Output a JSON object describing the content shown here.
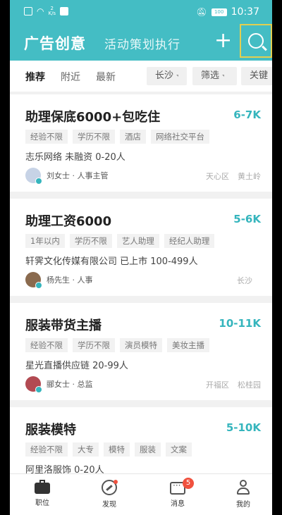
{
  "status_bar": {
    "speed_value": "2",
    "speed_unit": "K/s",
    "battery": "100",
    "time": "10:37"
  },
  "header": {
    "title": "广告创意",
    "subtitle": "活动策划执行",
    "plus_icon": "plus-icon",
    "search_icon": "search-icon"
  },
  "filters": {
    "tabs": [
      "推荐",
      "附近",
      "最新"
    ],
    "chips": [
      "长沙",
      "筛选",
      "关键"
    ]
  },
  "jobs": [
    {
      "title": "助理保底6000+包吃住",
      "salary": "6-7K",
      "tags": [
        "经验不限",
        "学历不限",
        "酒店",
        "网络社交平台"
      ],
      "company": "志乐网络  未融资  0-20人",
      "recruiter": "刘女士 · 人事主管",
      "district": "天心区",
      "area": "黄土岭"
    },
    {
      "title": "助理工资6000",
      "salary": "5-6K",
      "tags": [
        "1年以内",
        "学历不限",
        "艺人助理",
        "经纪人助理"
      ],
      "company": "轩霁文化传媒有限公司  已上市  100-499人",
      "recruiter": "杨先生 · 人事",
      "district": "长沙",
      "area": ""
    },
    {
      "title": "服装带货主播",
      "salary": "10-11K",
      "tags": [
        "经验不限",
        "学历不限",
        "演员模特",
        "美妆主播"
      ],
      "company": "星光直播供应链  20-99人",
      "recruiter": "郦女士 · 总监",
      "district": "开福区",
      "area": "松桂园"
    },
    {
      "title": "服装模特",
      "salary": "5-10K",
      "tags": [
        "经验不限",
        "大专",
        "模特",
        "服装",
        "文案"
      ],
      "company": "阿里洛服饰  0-20人",
      "recruiter": "",
      "district": "",
      "area": ""
    }
  ],
  "bottom_nav": {
    "items": [
      "职位",
      "发现",
      "消息",
      "我的"
    ],
    "message_badge": "5"
  },
  "colors": {
    "accent": "#44bdc4",
    "salary": "#35b5bd",
    "badge": "#f0513e",
    "highlight_box": "#e2cf50"
  }
}
